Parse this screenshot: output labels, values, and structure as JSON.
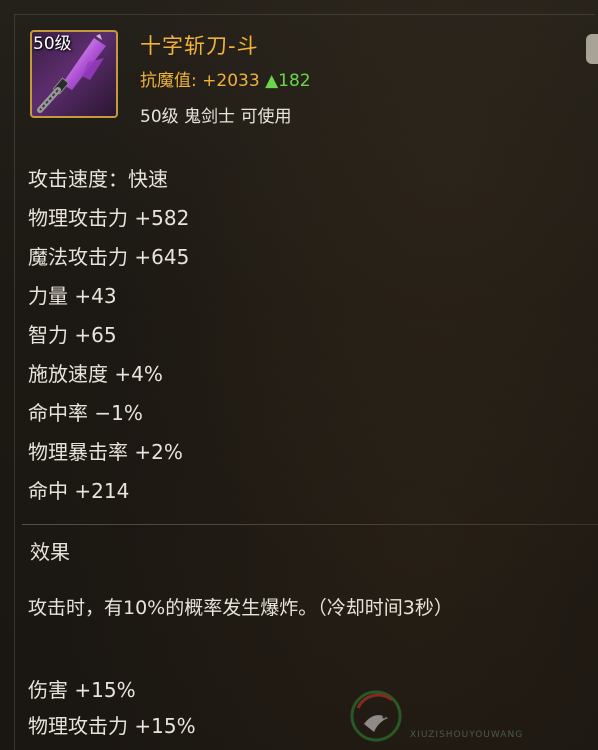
{
  "item": {
    "level_badge": "50级",
    "name": "十字斩刀-斗",
    "icon": "purple-katana-icon",
    "resist": {
      "label": "抗魔值:",
      "value": "+2033",
      "delta": "▲182"
    },
    "requirement": "50级 鬼剑士 可使用"
  },
  "stats": [
    "攻击速度：快速",
    "物理攻击力 +582",
    "魔法攻击力 +645",
    "力量 +43",
    "智力 +65",
    "施放速度 +4%",
    "命中率 −1%",
    "物理暴击率 +2%",
    "命中 +214"
  ],
  "effect": {
    "title": "效果",
    "description": "攻击时，有10%的概率发生爆炸。（冷却时间3秒）",
    "bonuses": [
      "伤害 +15%",
      "物理攻击力 +15%"
    ]
  },
  "watermark": {
    "logo": "bird-logo-icon",
    "sub": "XIUZISHOUYOUWANG"
  },
  "colors": {
    "name": "#f0b23a",
    "delta": "#67d84a",
    "text": "#e8e4dc",
    "icon_border": "#c59a3c"
  }
}
